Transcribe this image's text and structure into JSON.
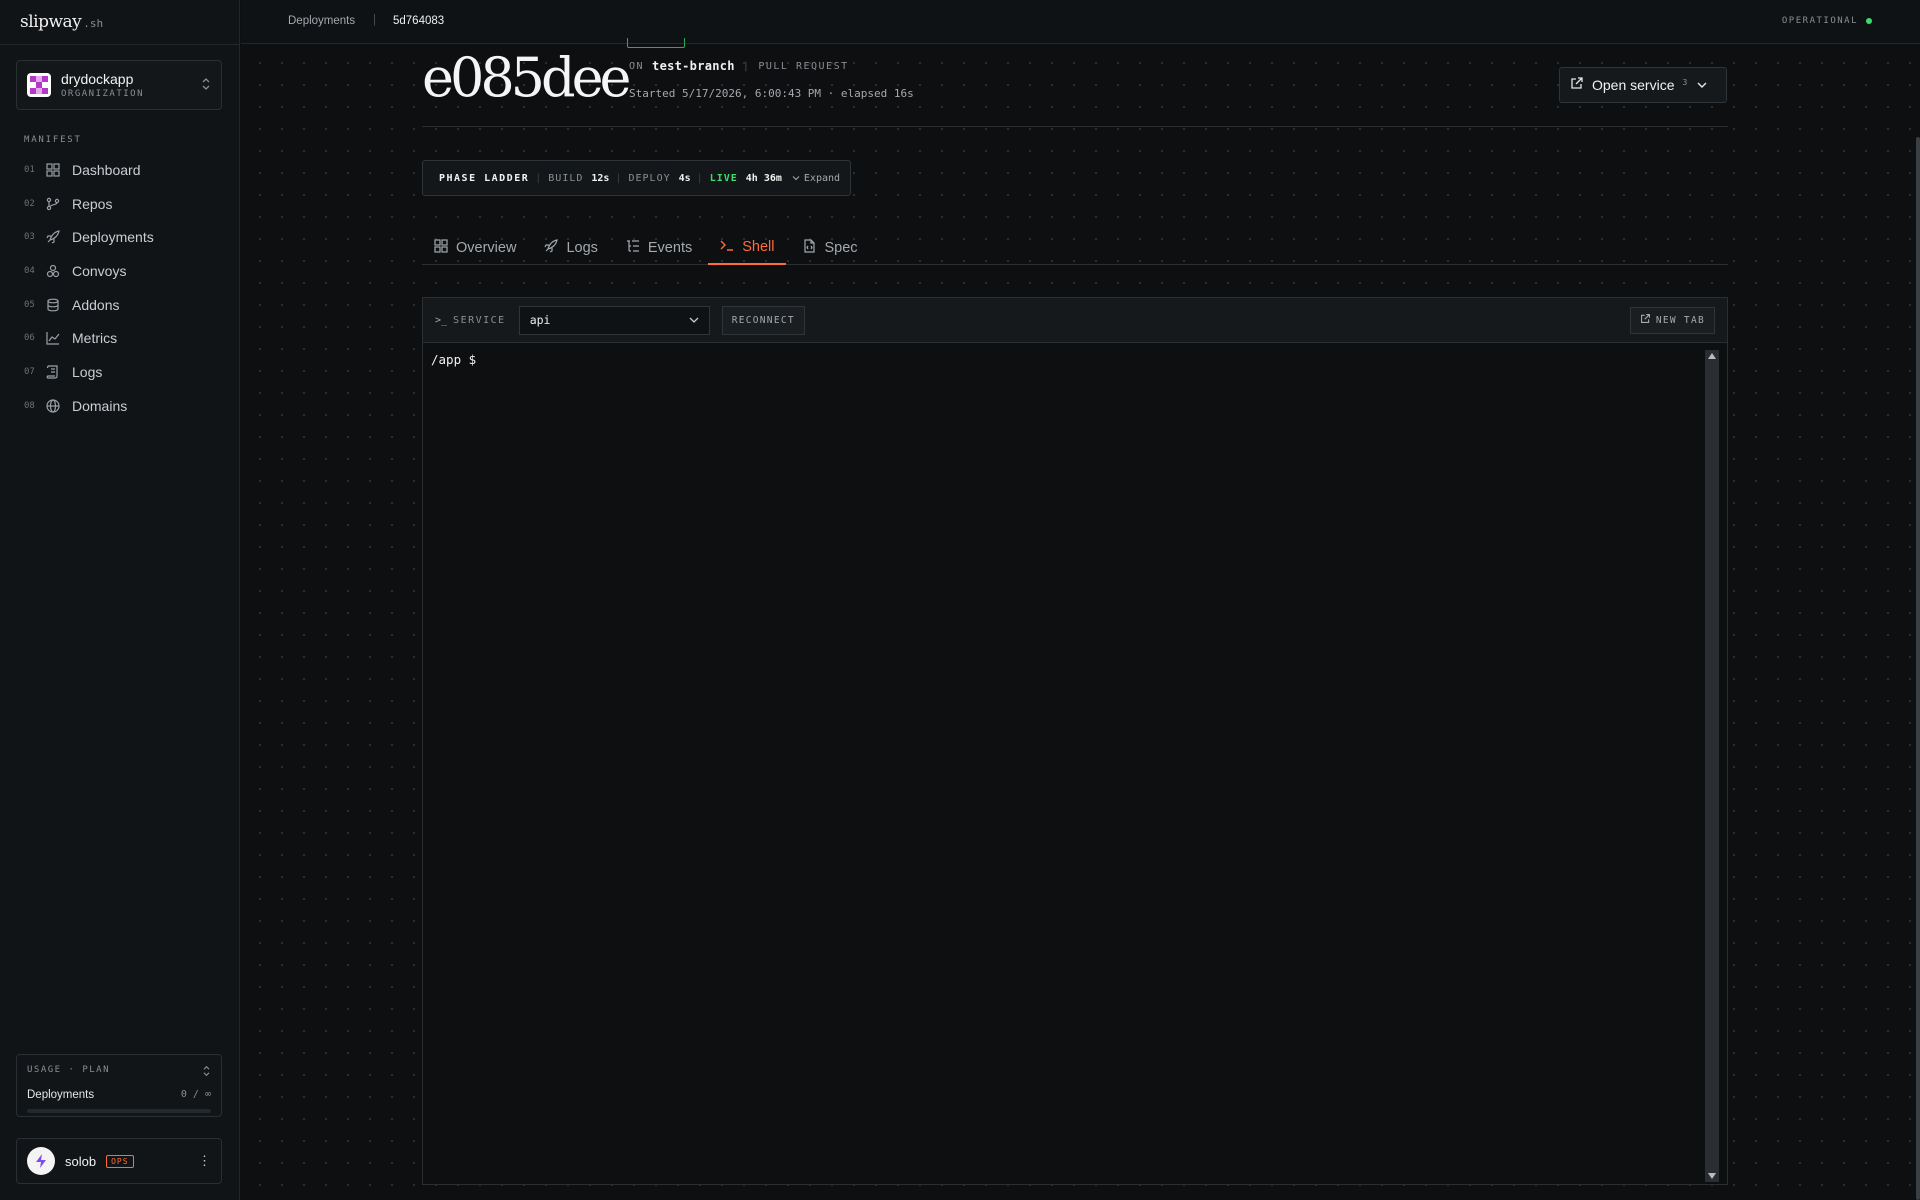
{
  "brand": {
    "name": "slipway",
    "tld": ".sh"
  },
  "org": {
    "name": "drydockapp",
    "role": "ORGANIZATION"
  },
  "sidebar": {
    "section": "MANIFEST",
    "items": [
      {
        "num": "01",
        "label": "Dashboard",
        "icon": "grid-icon"
      },
      {
        "num": "02",
        "label": "Repos",
        "icon": "git-branch-icon"
      },
      {
        "num": "03",
        "label": "Deployments",
        "icon": "rocket-icon"
      },
      {
        "num": "04",
        "label": "Convoys",
        "icon": "boxes-icon"
      },
      {
        "num": "05",
        "label": "Addons",
        "icon": "database-icon"
      },
      {
        "num": "06",
        "label": "Metrics",
        "icon": "chart-icon"
      },
      {
        "num": "07",
        "label": "Logs",
        "icon": "scroll-icon"
      },
      {
        "num": "08",
        "label": "Domains",
        "icon": "globe-icon"
      }
    ]
  },
  "usage": {
    "header": "USAGE · PLAN",
    "label": "Deployments",
    "value": "0 / ∞",
    "fraction": 0
  },
  "user": {
    "name": "solob",
    "badge": "OPS"
  },
  "topbar": {
    "crumb1": "Deployments",
    "sep": "|",
    "crumb2": "5d764083",
    "status": "OPERATIONAL",
    "status_color": "#3ddc6a"
  },
  "deployment": {
    "commit": "e085dee",
    "on_label": "ON",
    "branch": "test-branch",
    "kind": "PULL REQUEST",
    "started": "Started 5/17/2026, 6:00:43 PM · elapsed 16s"
  },
  "open_service": {
    "label": "Open service",
    "count": "3"
  },
  "phase": {
    "title": "PHASE LADDER",
    "build_label": "BUILD",
    "build_value": "12s",
    "deploy_label": "DEPLOY",
    "deploy_value": "4s",
    "live_label": "LIVE",
    "live_value": "4h 36m",
    "expand": "Expand"
  },
  "tabs": [
    {
      "label": "Overview",
      "icon": "grid-icon"
    },
    {
      "label": "Logs",
      "icon": "rocket-icon"
    },
    {
      "label": "Events",
      "icon": "list-icon"
    },
    {
      "label": "Shell",
      "icon": "terminal-icon",
      "active": true
    },
    {
      "label": "Spec",
      "icon": "file-code-icon"
    }
  ],
  "shell": {
    "prompt_glyph": ">_",
    "service_label": "SERVICE",
    "service_value": "api",
    "reconnect": "RECONNECT",
    "new_tab": "NEW TAB",
    "terminal_line": "/app $"
  },
  "colors": {
    "accent": "#ff6b3d",
    "live": "#3ddc6a"
  }
}
